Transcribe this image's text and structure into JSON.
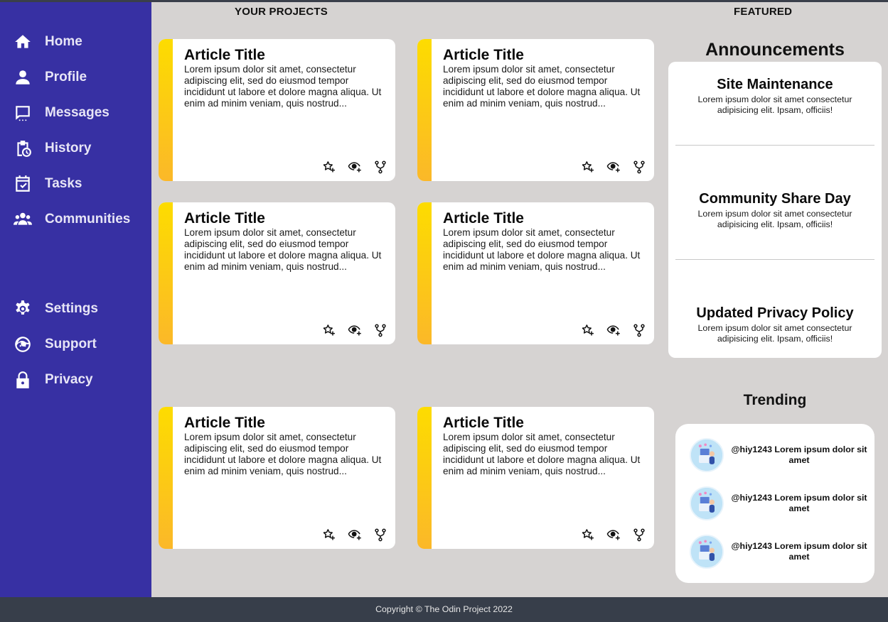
{
  "sidebar": {
    "items": [
      {
        "label": "Home",
        "icon": "home-icon"
      },
      {
        "label": "Profile",
        "icon": "person-icon"
      },
      {
        "label": "Messages",
        "icon": "message-icon"
      },
      {
        "label": "History",
        "icon": "history-icon"
      },
      {
        "label": "Tasks",
        "icon": "tasks-icon"
      },
      {
        "label": "Communities",
        "icon": "communities-icon"
      }
    ],
    "bottom_items": [
      {
        "label": "Settings",
        "icon": "gear-icon"
      },
      {
        "label": "Support",
        "icon": "support-icon"
      },
      {
        "label": "Privacy",
        "icon": "lock-icon"
      }
    ],
    "color": "#3730a3"
  },
  "projects": {
    "header": "YOUR PROJECTS",
    "cards": [
      {
        "title": "Article Title",
        "body": "Lorem ipsum dolor sit amet, consectetur adipiscing elit, sed do eiusmod tempor incididunt ut labore et dolore magna aliqua. Ut enim ad minim veniam, quis nostrud..."
      },
      {
        "title": "Article Title",
        "body": "Lorem ipsum dolor sit amet, consectetur adipiscing elit, sed do eiusmod tempor incididunt ut labore et dolore magna aliqua. Ut enim ad minim veniam, quis nostrud..."
      },
      {
        "title": "Article Title",
        "body": "Lorem ipsum dolor sit amet, consectetur adipiscing elit, sed do eiusmod tempor incididunt ut labore et dolore magna aliqua. Ut enim ad minim veniam, quis nostrud..."
      },
      {
        "title": "Article Title",
        "body": "Lorem ipsum dolor sit amet, consectetur adipiscing elit, sed do eiusmod tempor incididunt ut labore et dolore magna aliqua. Ut enim ad minim veniam, quis nostrud..."
      },
      {
        "title": "Article Title",
        "body": "Lorem ipsum dolor sit amet, consectetur adipiscing elit, sed do eiusmod tempor incididunt ut labore et dolore magna aliqua. Ut enim ad minim veniam, quis nostrud..."
      },
      {
        "title": "Article Title",
        "body": "Lorem ipsum dolor sit amet, consectetur adipiscing elit, sed do eiusmod tempor incididunt ut labore et dolore magna aliqua. Ut enim ad minim veniam, quis nostrud..."
      }
    ],
    "card_actions": [
      "star-add-icon",
      "eye-add-icon",
      "fork-icon"
    ],
    "stripe_colors": [
      "#fddc00",
      "#fbb829"
    ]
  },
  "featured": {
    "header": "FEATURED",
    "announcements_title": "Announcements",
    "announcements": [
      {
        "title": "Site Maintenance",
        "body": "Lorem ipsum dolor sit amet consectetur adipisicing elit. Ipsam, officiis!"
      },
      {
        "title": "Community Share Day",
        "body": "Lorem ipsum dolor sit amet consectetur adipisicing elit. Ipsam, officiis!"
      },
      {
        "title": "Updated Privacy Policy",
        "body": "Lorem ipsum dolor sit amet consectetur adipisicing elit. Ipsam, officiis!"
      }
    ],
    "trending_title": "Trending",
    "trending": [
      {
        "text": "@hiy1243 Lorem ipsum dolor sit amet"
      },
      {
        "text": "@hiy1243 Lorem ipsum dolor sit amet"
      },
      {
        "text": "@hiy1243 Lorem ipsum dolor sit amet"
      }
    ]
  },
  "footer": {
    "text": "Copyright © The Odin Project 2022"
  }
}
